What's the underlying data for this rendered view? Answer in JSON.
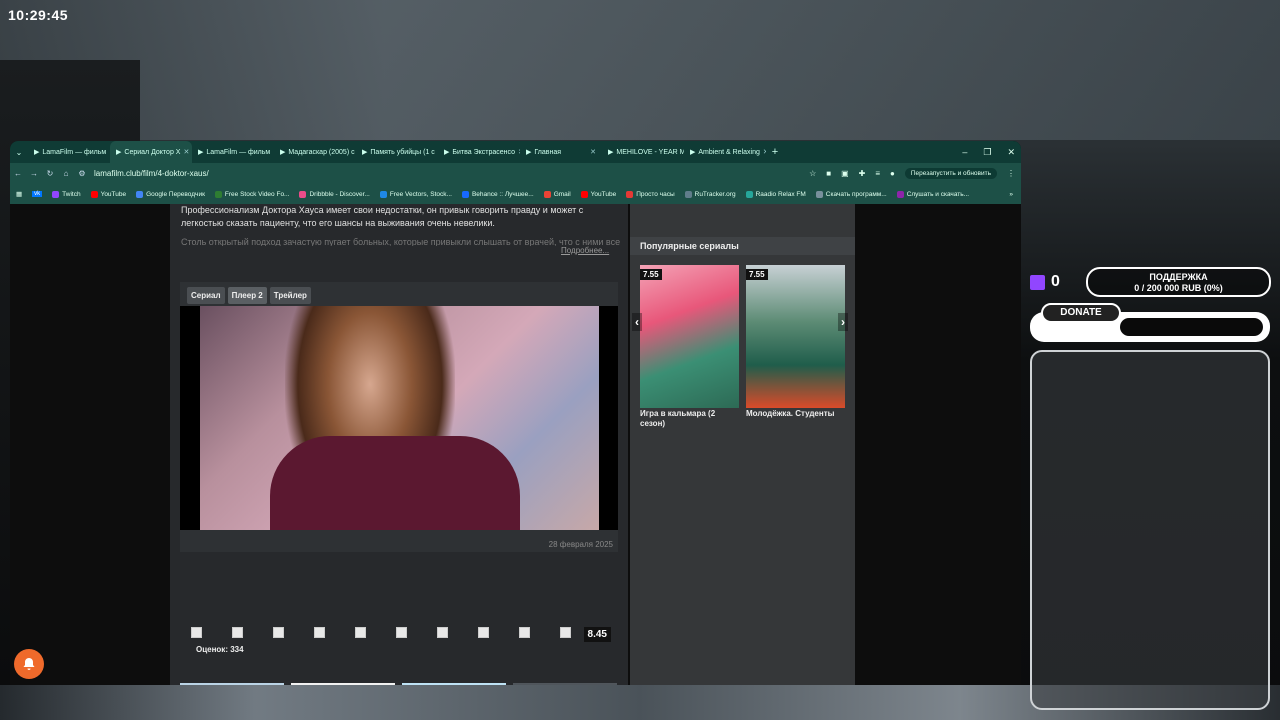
{
  "clock": "10:29:45",
  "browser": {
    "tabs": [
      {
        "label": "LamaFilm — фильм",
        "active": false
      },
      {
        "label": "Сериал Доктор Х",
        "active": true
      },
      {
        "label": "LamaFilm — фильм",
        "active": false
      },
      {
        "label": "Мадагаскар (2005) с",
        "active": false
      },
      {
        "label": "Память убийцы (1 с",
        "active": false
      },
      {
        "label": "Битва Экстрасенсо",
        "active": false
      },
      {
        "label": "Главная",
        "active": false
      },
      {
        "label": "MEHILOVE - YEAR M",
        "active": false
      },
      {
        "label": "Ambient & Relaxing",
        "active": false
      }
    ],
    "url": "lamafilm.club/film/4-doktor-xaus/",
    "restart_label": "Перезапустить и обновить",
    "bookmarks": [
      {
        "label": "Twitch",
        "color": "#9146ff"
      },
      {
        "label": "YouTube",
        "color": "#ff0000"
      },
      {
        "label": "Google Переводчик",
        "color": "#4285f4"
      },
      {
        "label": "Free Stock Video Fo...",
        "color": "#2e7d32"
      },
      {
        "label": "Dribbble - Discover...",
        "color": "#ea4c89"
      },
      {
        "label": "Free Vectors, Stock...",
        "color": "#1e88e5"
      },
      {
        "label": "Behance :: Лучшее...",
        "color": "#1769ff"
      },
      {
        "label": "Gmail",
        "color": "#ea4335"
      },
      {
        "label": "YouTube",
        "color": "#ff0000"
      },
      {
        "label": "Просто часы",
        "color": "#e53935"
      },
      {
        "label": "RuTracker.org",
        "color": "#607d8b"
      },
      {
        "label": "Raadio Relax FM",
        "color": "#26a69a"
      },
      {
        "label": "Скачать программ...",
        "color": "#78909c"
      },
      {
        "label": "Слушать и скачать...",
        "color": "#8e24aa"
      }
    ]
  },
  "film": {
    "description": "Профессионализм Доктора Хауса имеет свои недостатки, он привык говорить правду и может с легкостью сказать пациенту, что его шансы на выживания очень невелики.",
    "description_more": "Столь открытый подход зачастую пугает больных, которые привыкли слышать от врачей, что с ними все будет",
    "more_label": "Подробнее...",
    "player_tabs": [
      "Сериал",
      "Плеер 2",
      "Трейлер"
    ],
    "date": "28 февраля 2025",
    "score": "8.45",
    "votes": "Оценок: 334"
  },
  "sidebar": {
    "heading": "Популярные сериалы",
    "items": [
      {
        "rating": "7.55",
        "title": "Игра в кальмара (2 сезон)"
      },
      {
        "rating": "7.55",
        "title": "Молодёжка. Студенты"
      }
    ]
  },
  "stream": {
    "twitch_count": "0",
    "support_title": "ПОДДЕРЖКА",
    "support_progress": "0 / 200 000 RUB (0%)",
    "donate_label": "DONATE"
  }
}
